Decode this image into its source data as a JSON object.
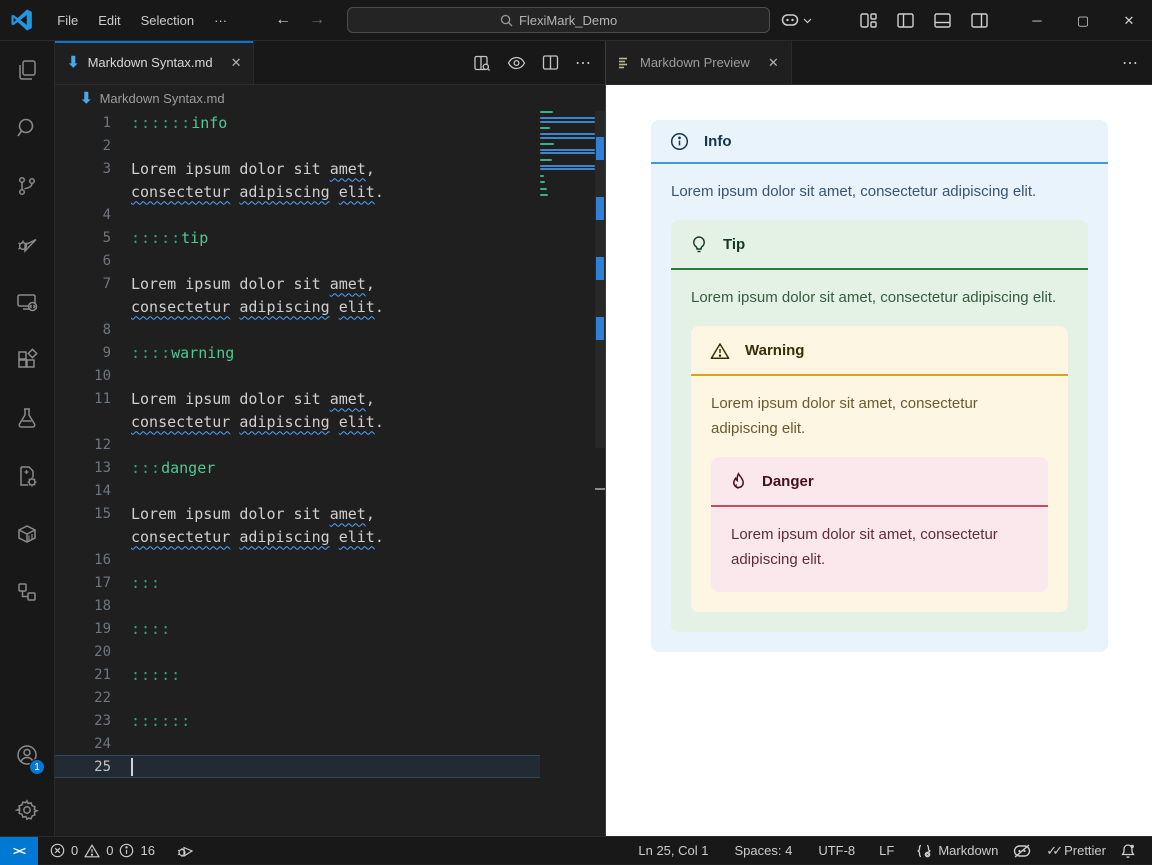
{
  "titlebar": {
    "menus": [
      "File",
      "Edit",
      "Selection"
    ],
    "menu_more": "···",
    "back_arrow": "←",
    "forward_arrow": "→",
    "search_value": "FlexiMark_Demo",
    "window_controls": {
      "minimize": "─",
      "maximize": "▢",
      "close": "✕"
    }
  },
  "activity_bar": {
    "top_icons": [
      "explorer",
      "search",
      "source-control",
      "run-and-debug",
      "remote-explorer",
      "extensions",
      "testing",
      "code-runner",
      "containers",
      "hierarchy"
    ],
    "bottom_icons": [
      "accounts",
      "settings"
    ],
    "accounts_badge": "1"
  },
  "editor": {
    "tab": {
      "label": "Markdown Syntax.md",
      "close": "✕"
    },
    "breadcrumb": {
      "label": "Markdown Syntax.md"
    },
    "action_icons": [
      "open-preview-to-side",
      "toggle-preview",
      "split-editor",
      "more-actions"
    ],
    "more_actions_glyph": "⋯",
    "colors": {
      "marker_colon": "#2da97f",
      "marker_keyword": "#4ec994",
      "squiggle": "#4da6ff"
    },
    "rows": [
      {
        "n": "1",
        "segs": [
          {
            "t": "::::::",
            "cls": "colon"
          },
          {
            "t": "info",
            "cls": "kw"
          }
        ]
      },
      {
        "n": "2",
        "segs": []
      },
      {
        "n": "3",
        "segs": [
          {
            "t": "Lorem ipsum dolor sit "
          },
          {
            "t": "amet",
            "cls": "sq"
          },
          {
            "t": ","
          }
        ]
      },
      {
        "n": "",
        "segs": [
          {
            "t": "consectetur",
            "cls": "sq"
          },
          {
            "t": " "
          },
          {
            "t": "adipiscing",
            "cls": "sq"
          },
          {
            "t": " "
          },
          {
            "t": "elit",
            "cls": "sq"
          },
          {
            "t": "."
          }
        ]
      },
      {
        "n": "4",
        "segs": []
      },
      {
        "n": "5",
        "segs": [
          {
            "t": ":::::",
            "cls": "colon"
          },
          {
            "t": "tip",
            "cls": "kw"
          }
        ]
      },
      {
        "n": "6",
        "segs": []
      },
      {
        "n": "7",
        "segs": [
          {
            "t": "Lorem ipsum dolor sit "
          },
          {
            "t": "amet",
            "cls": "sq"
          },
          {
            "t": ","
          }
        ]
      },
      {
        "n": "",
        "segs": [
          {
            "t": "consectetur",
            "cls": "sq"
          },
          {
            "t": " "
          },
          {
            "t": "adipiscing",
            "cls": "sq"
          },
          {
            "t": " "
          },
          {
            "t": "elit",
            "cls": "sq"
          },
          {
            "t": "."
          }
        ]
      },
      {
        "n": "8",
        "segs": []
      },
      {
        "n": "9",
        "segs": [
          {
            "t": "::::",
            "cls": "colon"
          },
          {
            "t": "warning",
            "cls": "kw"
          }
        ]
      },
      {
        "n": "10",
        "segs": []
      },
      {
        "n": "11",
        "segs": [
          {
            "t": "Lorem ipsum dolor sit "
          },
          {
            "t": "amet",
            "cls": "sq"
          },
          {
            "t": ","
          }
        ]
      },
      {
        "n": "",
        "segs": [
          {
            "t": "consectetur",
            "cls": "sq"
          },
          {
            "t": " "
          },
          {
            "t": "adipiscing",
            "cls": "sq"
          },
          {
            "t": " "
          },
          {
            "t": "elit",
            "cls": "sq"
          },
          {
            "t": "."
          }
        ]
      },
      {
        "n": "12",
        "segs": []
      },
      {
        "n": "13",
        "segs": [
          {
            "t": ":::",
            "cls": "colon"
          },
          {
            "t": "danger",
            "cls": "kw"
          }
        ]
      },
      {
        "n": "14",
        "segs": []
      },
      {
        "n": "15",
        "segs": [
          {
            "t": "Lorem ipsum dolor sit "
          },
          {
            "t": "amet",
            "cls": "sq"
          },
          {
            "t": ","
          }
        ]
      },
      {
        "n": "",
        "segs": [
          {
            "t": "consectetur",
            "cls": "sq"
          },
          {
            "t": " "
          },
          {
            "t": "adipiscing",
            "cls": "sq"
          },
          {
            "t": " "
          },
          {
            "t": "elit",
            "cls": "sq"
          },
          {
            "t": "."
          }
        ]
      },
      {
        "n": "16",
        "segs": []
      },
      {
        "n": "17",
        "segs": [
          {
            "t": ":::",
            "cls": "colon"
          }
        ]
      },
      {
        "n": "18",
        "segs": []
      },
      {
        "n": "19",
        "segs": [
          {
            "t": "::::",
            "cls": "colon"
          }
        ]
      },
      {
        "n": "20",
        "segs": []
      },
      {
        "n": "21",
        "segs": [
          {
            "t": ":::::",
            "cls": "colon"
          }
        ]
      },
      {
        "n": "22",
        "segs": []
      },
      {
        "n": "23",
        "segs": [
          {
            "t": "::::::",
            "cls": "colon"
          }
        ]
      },
      {
        "n": "24",
        "segs": []
      },
      {
        "n": "25",
        "segs": [],
        "current": true,
        "cursor": true
      }
    ]
  },
  "preview": {
    "tab": {
      "label": "Markdown Preview",
      "close": "✕"
    },
    "more_actions_glyph": "⋯",
    "admonitions": {
      "info": {
        "title": "Info",
        "body": "Lorem ipsum dolor sit amet, consectetur adipiscing elit.",
        "bg": "#e8f3fb",
        "accent": "#3f9bd8",
        "title_color": "#16344f",
        "body_color": "#3a5570",
        "icon": "info-circle"
      },
      "tip": {
        "title": "Tip",
        "body": "Lorem ipsum dolor sit amet, consectetur adipiscing elit.",
        "bg": "#e4f2e5",
        "accent": "#2a7e33",
        "title_color": "#153a1d",
        "body_color": "#355c3d",
        "icon": "lightbulb"
      },
      "warning": {
        "title": "Warning",
        "body": "Lorem ipsum dolor sit amet, consectetur adipiscing elit.",
        "bg": "#fdf6e2",
        "accent": "#d7a51c",
        "title_color": "#3a2e05",
        "body_color": "#6b5a2e",
        "icon": "warning-triangle"
      },
      "danger": {
        "title": "Danger",
        "body": "Lorem ipsum dolor sit amet, consectetur adipiscing elit.",
        "bg": "#fbe8ec",
        "accent": "#d2485e",
        "title_color": "#47101e",
        "body_color": "#5e2f3b",
        "icon": "flame"
      }
    }
  },
  "status_bar": {
    "remote_glyph": "><",
    "problems": {
      "errors": "0",
      "warnings": "0",
      "infos": "16"
    },
    "cursor_position": "Ln 25, Col 1",
    "indentation": "Spaces: 4",
    "encoding": "UTF-8",
    "eol": "LF",
    "language": "Markdown",
    "formatter": "Prettier"
  },
  "accent_colors": {
    "focus_blue": "#0078d4",
    "remote_blue": "#0078d4"
  }
}
